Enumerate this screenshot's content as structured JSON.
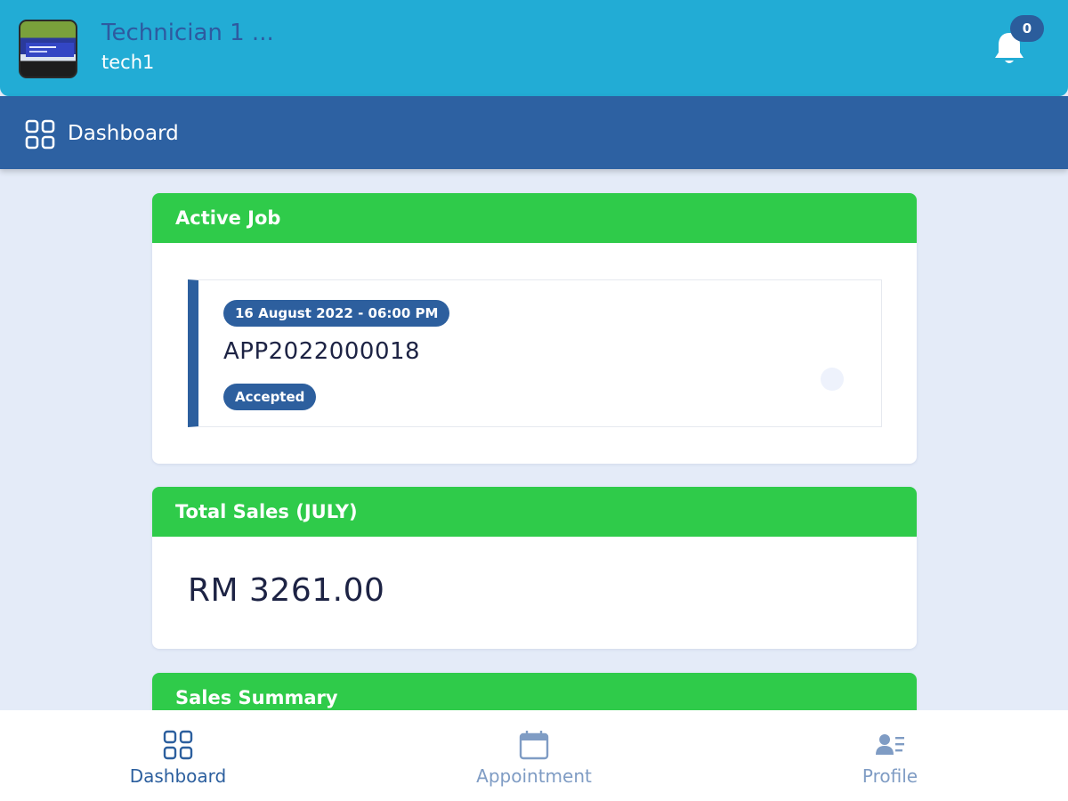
{
  "user": {
    "name": "Technician 1 ...",
    "id": "tech1"
  },
  "notifications": {
    "count": "0",
    "icon": "bell-icon"
  },
  "page": {
    "title": "Dashboard",
    "icon": "grid-icon"
  },
  "active_job": {
    "heading": "Active Job",
    "datetime": "16 August 2022 - 06:00 PM",
    "code": "APP2022000018",
    "status": "Accepted"
  },
  "total_sales": {
    "heading": "Total Sales (JULY)",
    "amount": "RM 3261.00"
  },
  "sales_summary": {
    "heading": "Sales Summary"
  },
  "bottom_nav": {
    "items": [
      {
        "label": "Dashboard",
        "icon": "grid-icon",
        "active": true
      },
      {
        "label": "Appointment",
        "icon": "calendar-icon",
        "active": false
      },
      {
        "label": "Profile",
        "icon": "profile-card-icon",
        "active": false
      }
    ]
  },
  "colors": {
    "top_bar": "#22acd5",
    "sub_header": "#2d61a2",
    "card_header": "#2fcb4a",
    "accent": "#2c5f9e",
    "background": "#e4ebf8"
  }
}
